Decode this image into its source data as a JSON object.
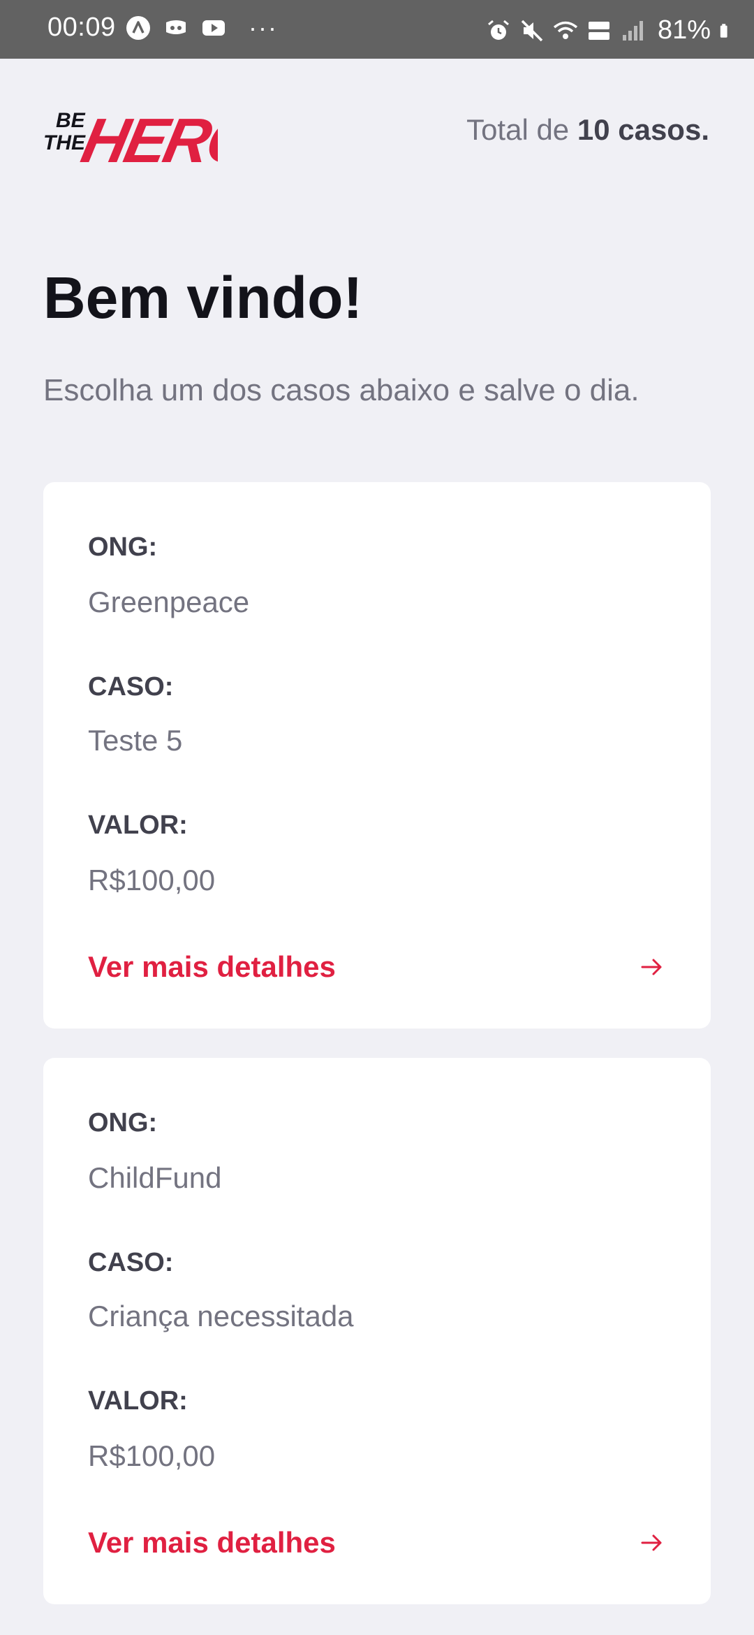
{
  "status_bar": {
    "time": "00:09",
    "left_icons": [
      "navigation-icon",
      "discord-icon",
      "youtube-icon"
    ],
    "more": "···",
    "right_icons": [
      "alarm-icon",
      "mute-icon",
      "wifi-icon",
      "volte-lte-icon",
      "signal-icon"
    ],
    "battery": "81%"
  },
  "header": {
    "logo_alt": "BE THE HERO",
    "total_prefix": "Total de ",
    "total_count": "10 casos."
  },
  "welcome": {
    "title": "Bem vindo!",
    "subtitle": "Escolha um dos casos abaixo e salve o dia."
  },
  "labels": {
    "ong": "ONG:",
    "caso": "CASO:",
    "valor": "VALOR:",
    "details": "Ver mais detalhes"
  },
  "incidents": [
    {
      "ong": "Greenpeace",
      "caso": "Teste 5",
      "valor": "R$100,00"
    },
    {
      "ong": "ChildFund",
      "caso": "Criança necessitada",
      "valor": "R$100,00"
    }
  ],
  "colors": {
    "accent": "#e02041",
    "background": "#f0f0f5",
    "status_bar": "#626262"
  }
}
